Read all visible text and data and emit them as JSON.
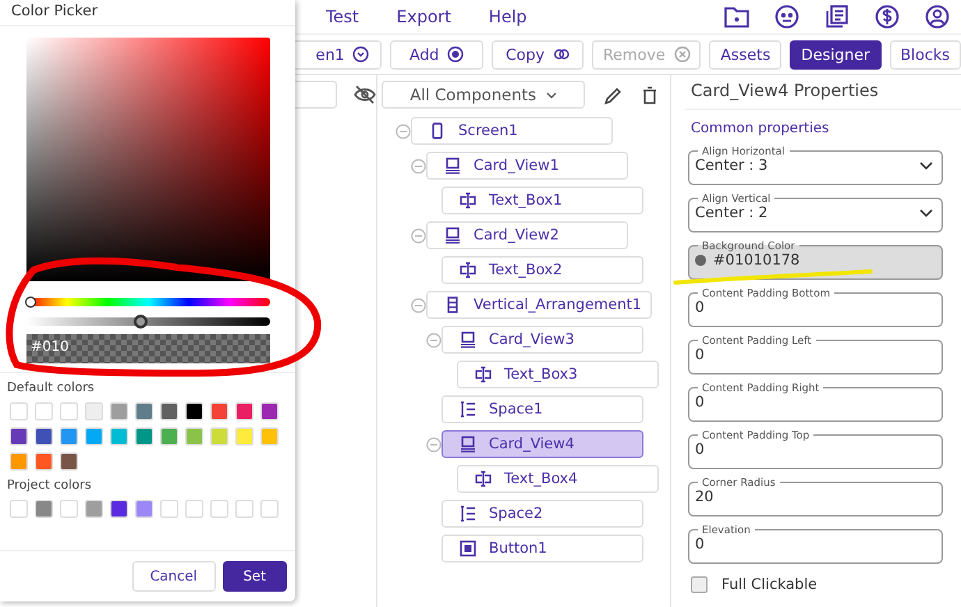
{
  "menu": [
    "Test",
    "Export",
    "Help"
  ],
  "toolbar": [
    {
      "label": "en1",
      "disabled": false
    },
    {
      "label": "Add",
      "disabled": false
    },
    {
      "label": "Copy",
      "disabled": false
    },
    {
      "label": "Remove",
      "disabled": true
    }
  ],
  "view_tabs": [
    {
      "label": "Assets",
      "selected": false
    },
    {
      "label": "Designer",
      "selected": true
    },
    {
      "label": "Blocks",
      "selected": false
    }
  ],
  "filter": {
    "label": "All Components"
  },
  "tree": [
    {
      "name": "Screen1",
      "kind": "screen",
      "expanded": true,
      "selected": false,
      "children": [
        {
          "name": "Card_View1",
          "kind": "card",
          "expanded": true,
          "selected": false,
          "children": [
            {
              "name": "Text_Box1",
              "kind": "textbox",
              "selected": false
            }
          ]
        },
        {
          "name": "Card_View2",
          "kind": "card",
          "expanded": true,
          "selected": false,
          "children": [
            {
              "name": "Text_Box2",
              "kind": "textbox",
              "selected": false
            }
          ]
        },
        {
          "name": "Vertical_Arrangement1",
          "kind": "arrangement",
          "expanded": true,
          "selected": false,
          "children": [
            {
              "name": "Card_View3",
              "kind": "card",
              "expanded": true,
              "selected": false,
              "children": [
                {
                  "name": "Text_Box3",
                  "kind": "textbox",
                  "selected": false
                }
              ]
            },
            {
              "name": "Space1",
              "kind": "space",
              "selected": false
            },
            {
              "name": "Card_View4",
              "kind": "card",
              "expanded": true,
              "selected": true,
              "children": [
                {
                  "name": "Text_Box4",
                  "kind": "textbox",
                  "selected": false
                }
              ]
            },
            {
              "name": "Space2",
              "kind": "space",
              "selected": false
            },
            {
              "name": "Button1",
              "kind": "button",
              "selected": false
            }
          ]
        }
      ]
    }
  ],
  "properties": {
    "title": "Card_View4 Properties",
    "section": "Common properties",
    "fields": [
      {
        "kind": "select",
        "label": "Align Horizontal",
        "value": "Center : 3"
      },
      {
        "kind": "select",
        "label": "Align Vertical",
        "value": "Center : 2"
      },
      {
        "kind": "color",
        "label": "Background Color",
        "value": "#01010178"
      },
      {
        "kind": "text",
        "label": "Content Padding Bottom",
        "value": "0"
      },
      {
        "kind": "text",
        "label": "Content Padding Left",
        "value": "0"
      },
      {
        "kind": "text",
        "label": "Content Padding Right",
        "value": "0"
      },
      {
        "kind": "text",
        "label": "Content Padding Top",
        "value": "0"
      },
      {
        "kind": "text",
        "label": "Corner Radius",
        "value": "20"
      },
      {
        "kind": "text",
        "label": "Elevation",
        "value": "0"
      },
      {
        "kind": "checkbox",
        "label": "Full Clickable",
        "checked": false
      }
    ]
  },
  "color_picker": {
    "title": "Color Picker",
    "hue": {
      "level": 0
    },
    "alpha": {
      "level": 0.46
    },
    "hex": "#010",
    "default_label": "Default colors",
    "default_colors": [
      {
        "color": "#ffffff"
      },
      {
        "color": "#ffffff"
      },
      {
        "color": "#ffffff"
      },
      {
        "color": "#eeeeee"
      },
      {
        "color": "#9e9e9e"
      },
      {
        "color": "#607d8b"
      },
      {
        "color": "#616161"
      },
      {
        "color": "#000000"
      },
      {
        "color": "#f44336"
      },
      {
        "color": "#e91e63"
      },
      {
        "color": "#9c27b0"
      },
      {
        "color": "#673ab7"
      },
      {
        "color": "#3f51b5"
      },
      {
        "color": "#2196f3"
      },
      {
        "color": "#03a9f4"
      },
      {
        "color": "#00bcd4"
      },
      {
        "color": "#009688"
      },
      {
        "color": "#4caf50"
      },
      {
        "color": "#8bc34a"
      },
      {
        "color": "#cddc39"
      },
      {
        "color": "#ffeb3b"
      },
      {
        "color": "#ffc107"
      },
      {
        "color": "#ff9800"
      },
      {
        "color": "#ff5722"
      },
      {
        "color": "#795548"
      }
    ],
    "project_label": "Project colors",
    "project_colors": [
      {
        "color": "#ffffff"
      },
      {
        "color": "#888888"
      },
      {
        "color": "#ffffff"
      },
      {
        "color": "#9e9e9e"
      },
      {
        "color": "#5b2be0"
      },
      {
        "color": "#9b87f5"
      },
      {
        "color": "#ffffff"
      },
      {
        "color": "#ffffff"
      },
      {
        "color": "#ffffff"
      },
      {
        "color": "#ffffff"
      },
      {
        "color": "#ffffff"
      }
    ],
    "buttons": [
      {
        "label": "Cancel",
        "kind": "secondary"
      },
      {
        "label": "Set",
        "kind": "primary"
      }
    ]
  }
}
